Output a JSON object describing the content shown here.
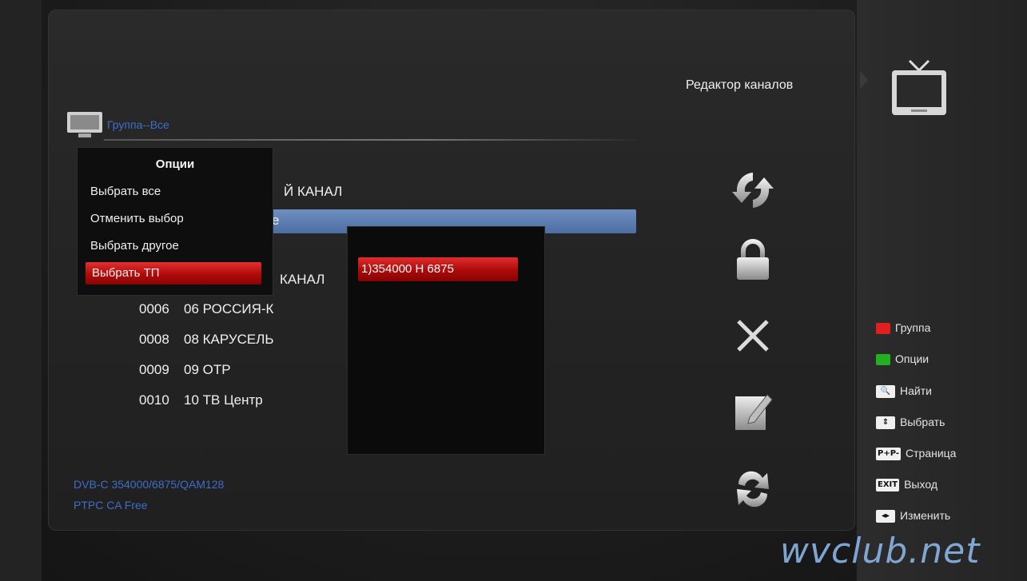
{
  "screen": {
    "title": "Редактор каналов",
    "group_label": "Группа--Все"
  },
  "channel_list": {
    "rows": [
      {
        "text": "Й КАНАЛ"
      },
      {
        "text": "е"
      },
      {
        "text": "КАНАЛ"
      },
      {
        "num": "0006",
        "name": "06 РОССИЯ-К"
      },
      {
        "num": "0008",
        "name": "08 КАРУСЕЛЬ"
      },
      {
        "num": "0009",
        "name": "09 ОТР"
      },
      {
        "num": "0010",
        "name": "10 ТВ Центр"
      }
    ]
  },
  "options_menu": {
    "title": "Опции",
    "items": [
      "Выбрать все",
      "Отменить выбор",
      "Выбрать другое",
      "Выбрать ТП"
    ],
    "selected_index": 3
  },
  "tp_list": {
    "items": [
      "1)354000 H 6875"
    ],
    "selected_index": 0
  },
  "info": {
    "line1": "DVB-C  354000/6875/QAM128",
    "line2": "PTPC  CA Free"
  },
  "legend": [
    {
      "key_type": "color",
      "key_color": "#e02020",
      "label": "Группа"
    },
    {
      "key_type": "color",
      "key_color": "#22b022",
      "label": "Опции"
    },
    {
      "key_type": "icon",
      "key_icon": "search-icon",
      "label": "Найти"
    },
    {
      "key_type": "text",
      "key_text": "⇕",
      "label": "Выбрать"
    },
    {
      "key_type": "text",
      "key_text": "P+P-",
      "label": "Страница"
    },
    {
      "key_type": "text",
      "key_text": "EXIT",
      "label": "Выход"
    },
    {
      "key_type": "text",
      "key_text": "◂▸",
      "label": "Изменить"
    }
  ],
  "side_icons": [
    "refresh-icon",
    "lock-icon",
    "delete-icon",
    "rename-icon",
    "move-icon"
  ],
  "watermark": "wvclub.net",
  "colors": {
    "accent_red": "#c01010",
    "highlight_blue": "#5a7cb0",
    "info_blue": "#3c6fc8"
  }
}
